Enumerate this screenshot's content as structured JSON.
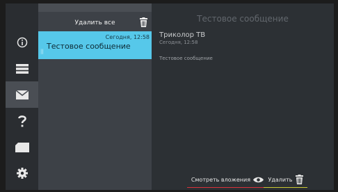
{
  "rail": {
    "items": [
      {
        "icon": "info-icon"
      },
      {
        "icon": "list-icon"
      },
      {
        "icon": "mail-icon",
        "active": true
      },
      {
        "icon": "help-icon"
      },
      {
        "icon": "card-icon"
      },
      {
        "icon": "gear-icon"
      }
    ]
  },
  "list": {
    "delete_all_label": "Удалить все",
    "messages": [
      {
        "date": "Сегодня, 12:58",
        "title": "Тестовое сообщение",
        "selected": true
      }
    ]
  },
  "detail": {
    "heading": "Тестовое сообщение",
    "sender": "Триколор ТВ",
    "date": "Сегодня, 12:58",
    "body": "Тестовое сообщение"
  },
  "actions": {
    "view_attachments_label": "Смотреть вложения",
    "delete_label": "Удалить"
  },
  "colors": {
    "accent": "#56c8ea",
    "attach_underline": "#d8313a",
    "delete_underline": "#c9c832"
  }
}
